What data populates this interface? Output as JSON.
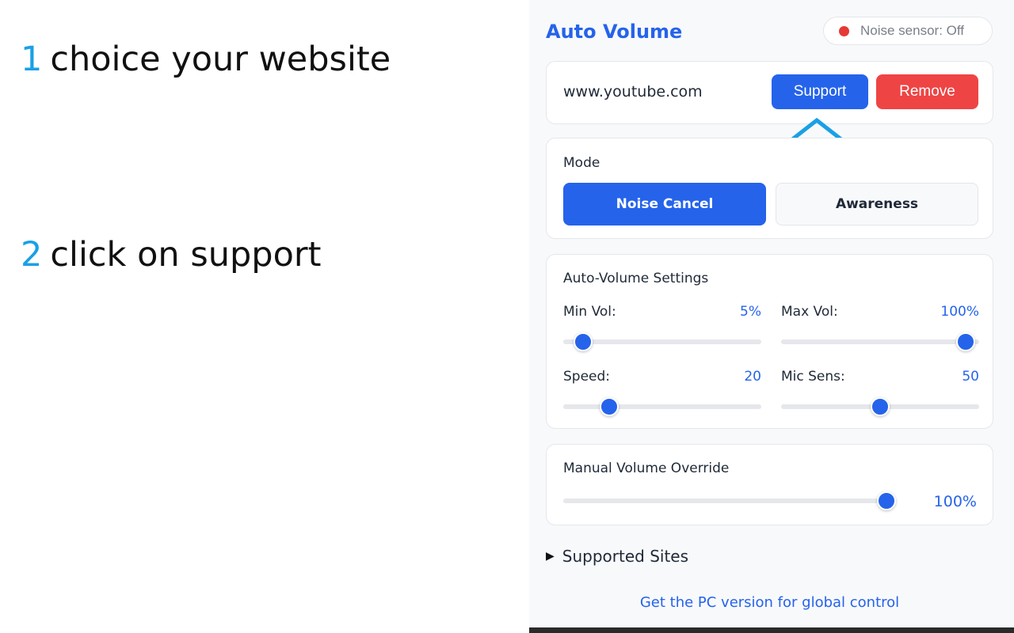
{
  "instructions": [
    {
      "number": "1",
      "text": "choice your website"
    },
    {
      "number": "2",
      "text": "click on support"
    }
  ],
  "popup": {
    "title": "Auto Volume",
    "noise_sensor": {
      "label": "Noise sensor: Off",
      "status_color": "#e53935"
    },
    "site": {
      "name": "www.youtube.com",
      "support_label": "Support",
      "remove_label": "Remove"
    },
    "mode": {
      "label": "Mode",
      "options": [
        "Noise Cancel",
        "Awareness"
      ],
      "selected": "Noise Cancel"
    },
    "settings": {
      "label": "Auto-Volume Settings",
      "min_vol": {
        "label": "Min Vol:",
        "value": "5%",
        "fraction": 0.1
      },
      "max_vol": {
        "label": "Max Vol:",
        "value": "100%",
        "fraction": 0.93
      },
      "speed": {
        "label": "Speed:",
        "value": "20",
        "fraction": 0.23
      },
      "mic_sens": {
        "label": "Mic Sens:",
        "value": "50",
        "fraction": 0.5
      }
    },
    "manual": {
      "label": "Manual Volume Override",
      "value": "100%",
      "fraction": 1.0
    },
    "supported_sites": {
      "label": "Supported Sites",
      "caret": "▶"
    },
    "pc_link": "Get the PC version for global control"
  },
  "annotation": {
    "icon": "up-arrow-icon",
    "color": "#1aa0e6"
  },
  "colors": {
    "accent": "#2563eb",
    "danger": "#ef4444",
    "instruction_number": "#1aa0e6"
  }
}
